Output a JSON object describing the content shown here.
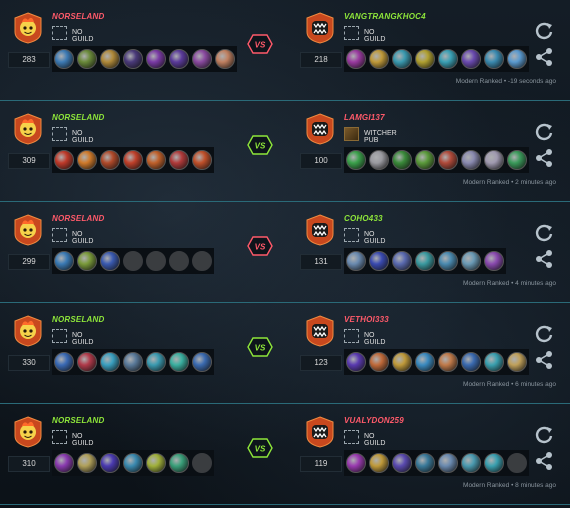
{
  "colors": {
    "win": "#8ee63a",
    "loss": "#ff5a6a",
    "accent_border": "#2a6a78"
  },
  "matches": [
    {
      "left": {
        "name": "NORSELAND",
        "result": "loss",
        "level": "283",
        "guild": "NO GUILD",
        "guild_icon": "empty-guild",
        "heroes": [
          "#3d7bb5",
          "#6a8a3a",
          "#b08a3a",
          "#4a3a7a",
          "#7a3aa5",
          "#5a3a9a",
          "#8a4aa0",
          "#c08060"
        ]
      },
      "right": {
        "name": "VANGTRANGKHOC4",
        "result": "win",
        "level": "218",
        "guild": "NO GUILD",
        "guild_icon": "empty-guild",
        "heroes": [
          "#9a3aa0",
          "#c09a3a",
          "#3a9ab0",
          "#b0a030",
          "#3aa0b5",
          "#6a4ab0",
          "#3a8ab0",
          "#5a9ad0"
        ]
      },
      "vs_result": "loss",
      "meta": "Modern Ranked • -19 seconds ago"
    },
    {
      "left": {
        "name": "NORSELAND",
        "result": "win",
        "level": "309",
        "guild": "NO GUILD",
        "guild_icon": "empty-guild",
        "heroes": [
          "#c03a2a",
          "#d07a2a",
          "#b04a2a",
          "#c0402a",
          "#c0602a",
          "#b03a3a",
          "#c0502a"
        ]
      },
      "right": {
        "name": "LAMGI137",
        "result": "loss",
        "level": "100",
        "guild": "WITCHER PUB",
        "guild_icon": "witcher-pub-emblem",
        "heroes": [
          "#3aa04a",
          "#9a9aa0",
          "#3a8a3a",
          "#5a9a3a",
          "#b04a3a",
          "#8a8ab0",
          "#a09ab0",
          "#3a9a5a"
        ]
      },
      "vs_result": "win",
      "meta": "Modern Ranked • 2 minutes ago"
    },
    {
      "left": {
        "name": "NORSELAND",
        "result": "loss",
        "level": "299",
        "guild": "NO GUILD",
        "guild_icon": "empty-guild",
        "heroes": [
          "#3a7ab5",
          "#7a9a3a",
          "#3a5ab0",
          "empty",
          "empty",
          "empty",
          "empty"
        ]
      },
      "right": {
        "name": "COHO433",
        "result": "win",
        "level": "131",
        "guild": "NO GUILD",
        "guild_icon": "empty-guild",
        "heroes": [
          "#6a8ab0",
          "#3a4ab0",
          "#5a6ab0",
          "#3a9aa0",
          "#4a8ab0",
          "#6a9ab5",
          "#8a4ab0"
        ]
      },
      "vs_result": "loss",
      "meta": "Modern Ranked • 4 minutes ago"
    },
    {
      "left": {
        "name": "NORSELAND",
        "result": "win",
        "level": "330",
        "guild": "NO GUILD",
        "guild_icon": "empty-guild",
        "heroes": [
          "#3a6ab5",
          "#b03a4a",
          "#3aa0c0",
          "#5a7a9a",
          "#3a9ab0",
          "#3ab0a0",
          "#3a6ab0"
        ]
      },
      "right": {
        "name": "VETHOI333",
        "result": "loss",
        "level": "123",
        "guild": "NO GUILD",
        "guild_icon": "empty-guild",
        "heroes": [
          "#5a3ab0",
          "#c06a3a",
          "#c09a3a",
          "#3a8ac0",
          "#c07a4a",
          "#3a6ab0",
          "#3aa0b0",
          "#c0a05a"
        ]
      },
      "vs_result": "win",
      "meta": "Modern Ranked • 6 minutes ago"
    },
    {
      "left": {
        "name": "NORSELAND",
        "result": "win",
        "level": "310",
        "guild": "NO GUILD",
        "guild_icon": "empty-guild",
        "heroes": [
          "#8a3ab0",
          "#b0a05a",
          "#4a3ab0",
          "#3a8ab0",
          "#a0b03a",
          "#3aa07a",
          "empty"
        ]
      },
      "right": {
        "name": "VUALYDON259",
        "result": "loss",
        "level": "119",
        "guild": "NO GUILD",
        "guild_icon": "empty-guild",
        "heroes": [
          "#9a3ab0",
          "#c09a3a",
          "#5a4ab0",
          "#3a7a9a",
          "#6a8ab0",
          "#4a9ab0",
          "#3aa0b0",
          "empty"
        ]
      },
      "vs_result": "win",
      "meta": "Modern Ranked • 8 minutes ago"
    }
  ],
  "vs_label": "VS",
  "icons": {
    "refresh": "refresh-icon",
    "share": "share-icon",
    "left_avatar": "fire-mascot-avatar-icon",
    "right_avatar": "monster-mouth-avatar-icon"
  }
}
